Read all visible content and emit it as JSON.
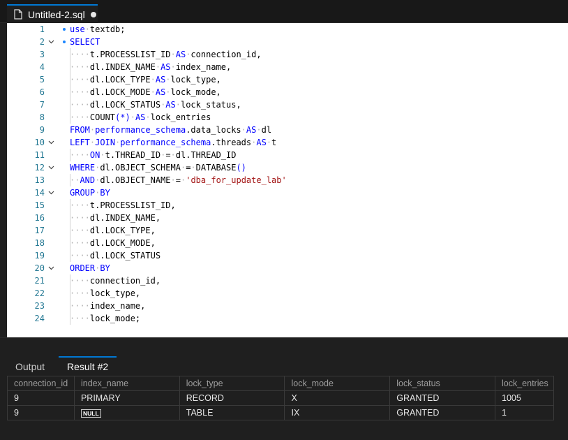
{
  "tab": {
    "title": "Untitled-2.sql",
    "file_icon": "file-icon",
    "dirty_icon": "dirty-dot-icon"
  },
  "editor": {
    "lines": [
      {
        "num": "1",
        "fold": "",
        "bullet": true,
        "indent": 0,
        "tokens": [
          [
            "kw",
            "use"
          ],
          [
            "sp",
            "·"
          ],
          [
            "op",
            "textdb;"
          ]
        ]
      },
      {
        "num": "2",
        "fold": "v",
        "bullet": true,
        "indent": 0,
        "tokens": [
          [
            "kw",
            "SELECT"
          ]
        ]
      },
      {
        "num": "3",
        "fold": "",
        "bullet": false,
        "indent": 1,
        "tokens": [
          [
            "sp",
            "····"
          ],
          [
            "op",
            "t.PROCESSLIST_ID"
          ],
          [
            "sp",
            "·"
          ],
          [
            "kw",
            "AS"
          ],
          [
            "sp",
            "·"
          ],
          [
            "op",
            "connection_id,"
          ]
        ]
      },
      {
        "num": "4",
        "fold": "",
        "bullet": false,
        "indent": 1,
        "tokens": [
          [
            "sp",
            "····"
          ],
          [
            "op",
            "dl.INDEX_NAME"
          ],
          [
            "sp",
            "·"
          ],
          [
            "kw",
            "AS"
          ],
          [
            "sp",
            "·"
          ],
          [
            "op",
            "index_name,"
          ]
        ]
      },
      {
        "num": "5",
        "fold": "",
        "bullet": false,
        "indent": 1,
        "tokens": [
          [
            "sp",
            "····"
          ],
          [
            "op",
            "dl.LOCK_TYPE"
          ],
          [
            "sp",
            "·"
          ],
          [
            "kw",
            "AS"
          ],
          [
            "sp",
            "·"
          ],
          [
            "op",
            "lock_type,"
          ]
        ]
      },
      {
        "num": "6",
        "fold": "",
        "bullet": false,
        "indent": 1,
        "tokens": [
          [
            "sp",
            "····"
          ],
          [
            "op",
            "dl.LOCK_MODE"
          ],
          [
            "sp",
            "·"
          ],
          [
            "kw",
            "AS"
          ],
          [
            "sp",
            "·"
          ],
          [
            "op",
            "lock_mode,"
          ]
        ]
      },
      {
        "num": "7",
        "fold": "",
        "bullet": false,
        "indent": 1,
        "tokens": [
          [
            "sp",
            "····"
          ],
          [
            "op",
            "dl.LOCK_STATUS"
          ],
          [
            "sp",
            "·"
          ],
          [
            "kw",
            "AS"
          ],
          [
            "sp",
            "·"
          ],
          [
            "op",
            "lock_status,"
          ]
        ]
      },
      {
        "num": "8",
        "fold": "",
        "bullet": false,
        "indent": 1,
        "tokens": [
          [
            "sp",
            "····"
          ],
          [
            "op",
            "COUNT"
          ],
          [
            "kw",
            "(*)"
          ],
          [
            "sp",
            "·"
          ],
          [
            "kw",
            "AS"
          ],
          [
            "sp",
            "·"
          ],
          [
            "op",
            "lock_entries"
          ]
        ]
      },
      {
        "num": "9",
        "fold": "",
        "bullet": false,
        "indent": 0,
        "tokens": [
          [
            "kw",
            "FROM"
          ],
          [
            "sp",
            "·"
          ],
          [
            "kw",
            "performance_schema"
          ],
          [
            "op",
            ".data_locks"
          ],
          [
            "sp",
            "·"
          ],
          [
            "kw",
            "AS"
          ],
          [
            "sp",
            "·"
          ],
          [
            "op",
            "dl"
          ]
        ]
      },
      {
        "num": "10",
        "fold": "v",
        "bullet": false,
        "indent": 0,
        "tokens": [
          [
            "kw",
            "LEFT"
          ],
          [
            "sp",
            "·"
          ],
          [
            "kw",
            "JOIN"
          ],
          [
            "sp",
            "·"
          ],
          [
            "kw",
            "performance_schema"
          ],
          [
            "op",
            ".threads"
          ],
          [
            "sp",
            "·"
          ],
          [
            "kw",
            "AS"
          ],
          [
            "sp",
            "·"
          ],
          [
            "op",
            "t"
          ]
        ]
      },
      {
        "num": "11",
        "fold": "",
        "bullet": false,
        "indent": 1,
        "tokens": [
          [
            "sp",
            "····"
          ],
          [
            "kw",
            "ON"
          ],
          [
            "sp",
            "·"
          ],
          [
            "op",
            "t.THREAD_ID"
          ],
          [
            "sp",
            "·"
          ],
          [
            "op",
            "="
          ],
          [
            "sp",
            "·"
          ],
          [
            "op",
            "dl.THREAD_ID"
          ]
        ]
      },
      {
        "num": "12",
        "fold": "v",
        "bullet": false,
        "indent": 0,
        "tokens": [
          [
            "kw",
            "WHERE"
          ],
          [
            "sp",
            "·"
          ],
          [
            "op",
            "dl.OBJECT_SCHEMA"
          ],
          [
            "sp",
            "·"
          ],
          [
            "op",
            "="
          ],
          [
            "sp",
            "·"
          ],
          [
            "op",
            "DATABASE"
          ],
          [
            "kw",
            "()"
          ]
        ]
      },
      {
        "num": "13",
        "fold": "",
        "bullet": false,
        "indent": 1,
        "tokens": [
          [
            "sp",
            "··"
          ],
          [
            "kw",
            "AND"
          ],
          [
            "sp",
            "·"
          ],
          [
            "op",
            "dl.OBJECT_NAME"
          ],
          [
            "sp",
            "·"
          ],
          [
            "op",
            "="
          ],
          [
            "sp",
            "·"
          ],
          [
            "str",
            "'dba_for_update_lab'"
          ]
        ]
      },
      {
        "num": "14",
        "fold": "v",
        "bullet": false,
        "indent": 0,
        "tokens": [
          [
            "kw",
            "GROUP"
          ],
          [
            "sp",
            "·"
          ],
          [
            "kw",
            "BY"
          ]
        ]
      },
      {
        "num": "15",
        "fold": "",
        "bullet": false,
        "indent": 1,
        "tokens": [
          [
            "sp",
            "····"
          ],
          [
            "op",
            "t.PROCESSLIST_ID,"
          ]
        ]
      },
      {
        "num": "16",
        "fold": "",
        "bullet": false,
        "indent": 1,
        "tokens": [
          [
            "sp",
            "····"
          ],
          [
            "op",
            "dl.INDEX_NAME,"
          ]
        ]
      },
      {
        "num": "17",
        "fold": "",
        "bullet": false,
        "indent": 1,
        "tokens": [
          [
            "sp",
            "····"
          ],
          [
            "op",
            "dl.LOCK_TYPE,"
          ]
        ]
      },
      {
        "num": "18",
        "fold": "",
        "bullet": false,
        "indent": 1,
        "tokens": [
          [
            "sp",
            "····"
          ],
          [
            "op",
            "dl.LOCK_MODE,"
          ]
        ]
      },
      {
        "num": "19",
        "fold": "",
        "bullet": false,
        "indent": 1,
        "tokens": [
          [
            "sp",
            "····"
          ],
          [
            "op",
            "dl.LOCK_STATUS"
          ]
        ]
      },
      {
        "num": "20",
        "fold": "v",
        "bullet": false,
        "indent": 0,
        "tokens": [
          [
            "kw",
            "ORDER"
          ],
          [
            "sp",
            "·"
          ],
          [
            "kw",
            "BY"
          ]
        ]
      },
      {
        "num": "21",
        "fold": "",
        "bullet": false,
        "indent": 1,
        "tokens": [
          [
            "sp",
            "····"
          ],
          [
            "op",
            "connection_id,"
          ]
        ]
      },
      {
        "num": "22",
        "fold": "",
        "bullet": false,
        "indent": 1,
        "tokens": [
          [
            "sp",
            "····"
          ],
          [
            "op",
            "lock_type,"
          ]
        ]
      },
      {
        "num": "23",
        "fold": "",
        "bullet": false,
        "indent": 1,
        "tokens": [
          [
            "sp",
            "····"
          ],
          [
            "op",
            "index_name,"
          ]
        ]
      },
      {
        "num": "24",
        "fold": "",
        "bullet": false,
        "indent": 1,
        "tokens": [
          [
            "sp",
            "····"
          ],
          [
            "op",
            "lock_mode;"
          ]
        ]
      }
    ]
  },
  "panel": {
    "tabs": [
      {
        "label": "Output",
        "active": false
      },
      {
        "label": "Result #2",
        "active": true
      }
    ]
  },
  "results": {
    "columns": [
      "connection_id",
      "index_name",
      "lock_type",
      "lock_mode",
      "lock_status",
      "lock_entries"
    ],
    "rows": [
      [
        "9",
        "PRIMARY",
        "RECORD",
        "X",
        "GRANTED",
        "1005"
      ],
      [
        "9",
        "NULL",
        "TABLE",
        "IX",
        "GRANTED",
        "1"
      ]
    ]
  },
  "colors": {
    "accent": "#0078d4",
    "keyword": "#0000ff",
    "string": "#a31515",
    "line_number": "#237893"
  }
}
